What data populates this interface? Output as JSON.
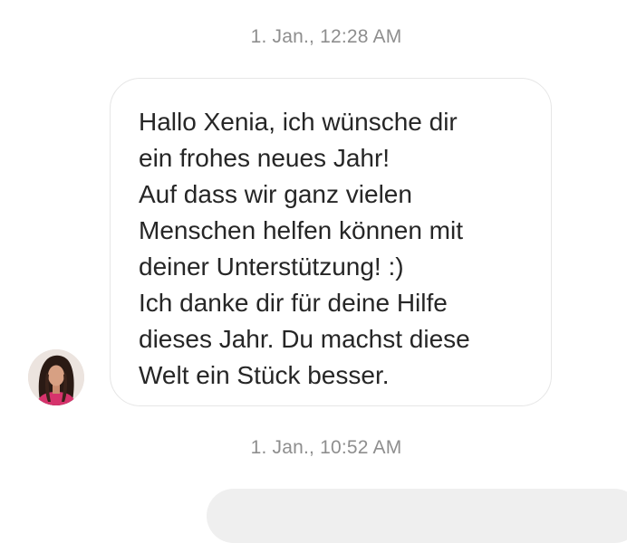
{
  "conversation": {
    "timestamps": [
      "1. Jan., 12:28 AM",
      "1. Jan., 10:52 AM"
    ],
    "incoming_message": {
      "lines": [
        "Hallo Xenia, ich wünsche dir",
        "ein frohes neues Jahr!",
        "Auf dass wir ganz vielen",
        "Menschen helfen können mit",
        "deiner Unterstützung! :)",
        "Ich danke dir für deine Hilfe",
        "dieses Jahr. Du machst diese",
        "Welt ein Stück besser."
      ]
    }
  }
}
